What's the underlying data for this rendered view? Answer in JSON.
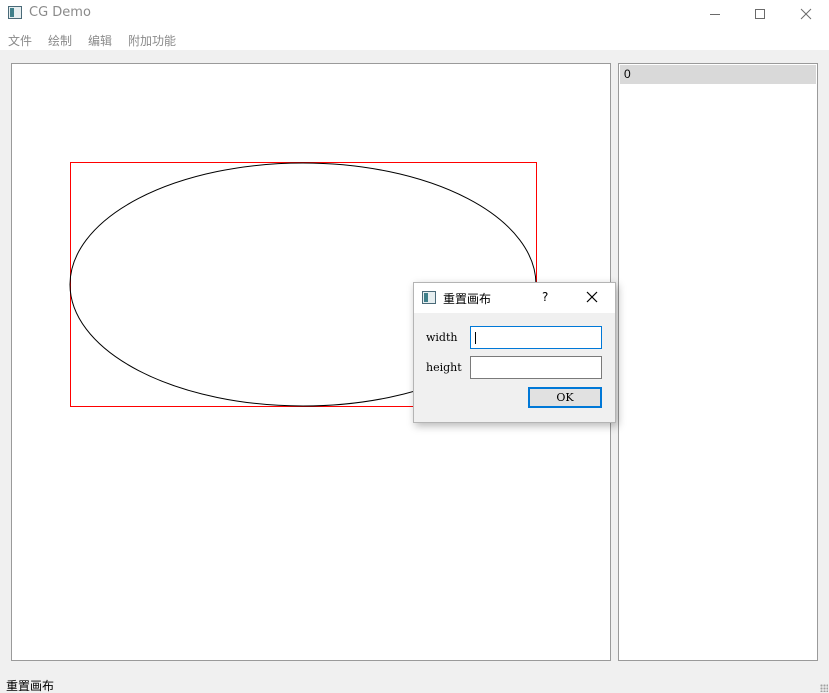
{
  "window": {
    "title": "CG Demo",
    "icon": "app-window-icon"
  },
  "menu": {
    "items": [
      "文件",
      "绘制",
      "编辑",
      "附加功能"
    ]
  },
  "canvas": {
    "shapes": [
      {
        "type": "rectangle",
        "stroke": "#ff0000"
      },
      {
        "type": "ellipse",
        "stroke": "#000000"
      }
    ]
  },
  "item_list": {
    "items": [
      "0"
    ]
  },
  "status_bar": {
    "message": "重置画布"
  },
  "dialog": {
    "title": "重置画布",
    "help_label": "?",
    "width_label": "width",
    "width_value": "",
    "height_label": "height",
    "height_value": "",
    "ok_label": "OK"
  },
  "colors": {
    "accent": "#0078d7",
    "selection": "#d9d9d9",
    "rect_stroke": "#ff0000"
  }
}
